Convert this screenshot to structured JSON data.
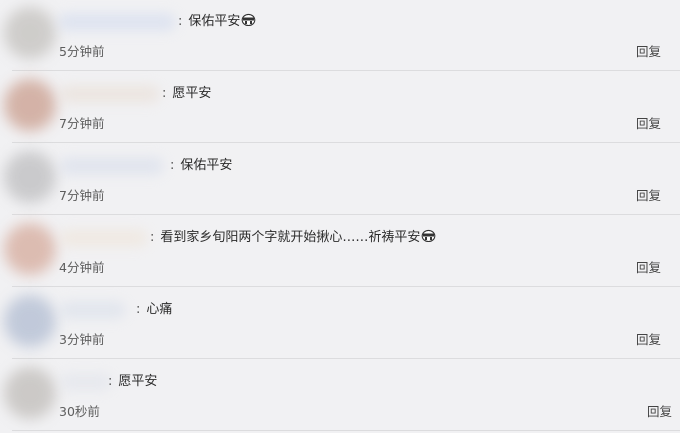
{
  "comments": [
    {
      "username": "",
      "text": "保佑平安",
      "has_emoji": true,
      "emoji_icon": "crying-face-emoji",
      "time": "5分钟前",
      "reply_label": "回复",
      "avatar_color": "#c9c7c4",
      "name_color": "#cfd9ee"
    },
    {
      "username": "",
      "text": "愿平安",
      "has_emoji": false,
      "time": "7分钟前",
      "reply_label": "回复",
      "avatar_color": "#cfa89a",
      "name_color": "#e8dcd2"
    },
    {
      "username": "",
      "text": "保佑平安",
      "has_emoji": false,
      "time": "7分钟前",
      "reply_label": "回复",
      "avatar_color": "#c4c4c6",
      "name_color": "#d4dbea"
    },
    {
      "username": "",
      "text": "看到家乡旬阳两个字就开始揪心……祈祷平安",
      "has_emoji": true,
      "emoji_icon": "crying-face-emoji",
      "time": "4分钟前",
      "reply_label": "回复",
      "avatar_color": "#d9b3a6",
      "name_color": "#efe3d6"
    },
    {
      "username": "",
      "text": "心痛",
      "has_emoji": false,
      "time": "3分钟前",
      "reply_label": "回复",
      "avatar_color": "#b9c3d6",
      "name_color": "#d6dde9"
    },
    {
      "username": "",
      "text": "愿平安",
      "has_emoji": false,
      "time": "30秒前",
      "reply_label": "回复",
      "avatar_color": "#c6c3c0",
      "name_color": "#dfe2ea"
    }
  ]
}
